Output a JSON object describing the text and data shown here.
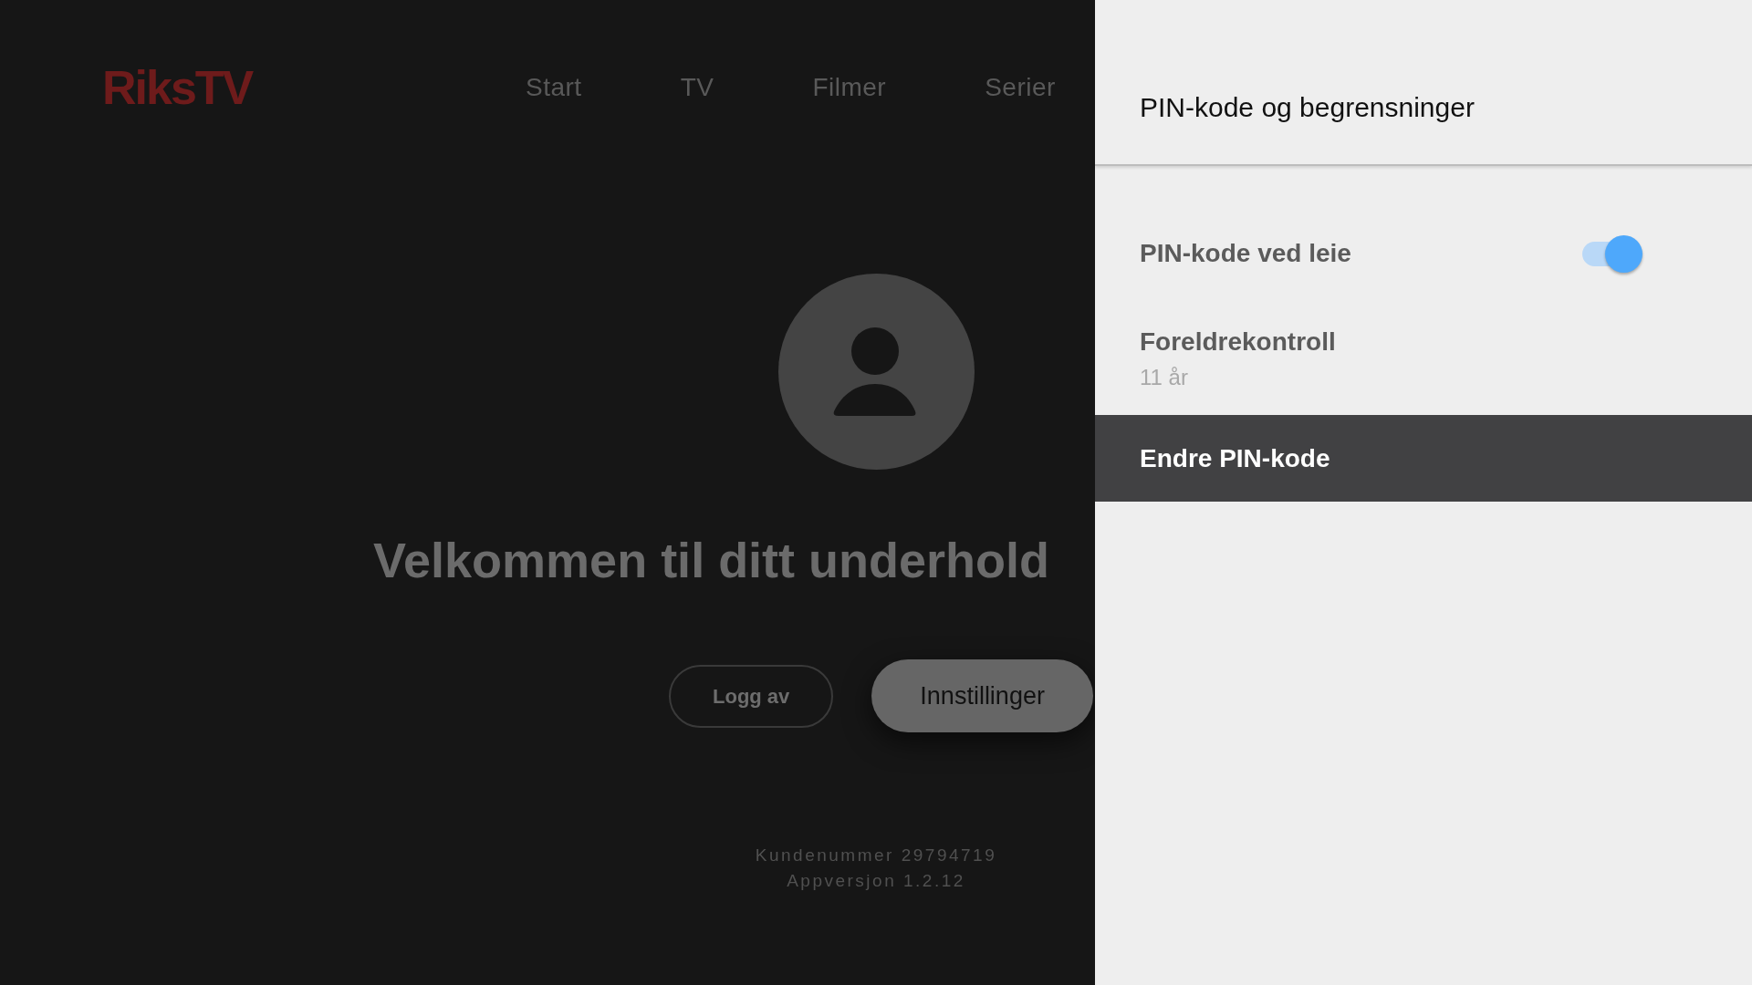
{
  "app": {
    "logo": "RiksTV",
    "nav": [
      {
        "label": "Start"
      },
      {
        "label": "TV"
      },
      {
        "label": "Filmer"
      },
      {
        "label": "Serier"
      }
    ],
    "profile": {
      "welcome": "Velkommen til ditt underhold",
      "buttons": [
        {
          "label": "Logg av",
          "focused": false
        },
        {
          "label": "Innstillinger",
          "focused": true
        }
      ],
      "customer_number": "Kundenummer 29794719",
      "app_version": "Appversjon 1.2.12"
    }
  },
  "settings_panel": {
    "title": "PIN-kode og begrensninger",
    "items": [
      {
        "kind": "toggle",
        "label": "PIN-kode ved leie",
        "on": true,
        "selected": false
      },
      {
        "kind": "value",
        "label": "Foreldrekontroll",
        "value": "11 år",
        "selected": false
      },
      {
        "kind": "action",
        "label": "Endre PIN-kode",
        "selected": true
      }
    ]
  }
}
